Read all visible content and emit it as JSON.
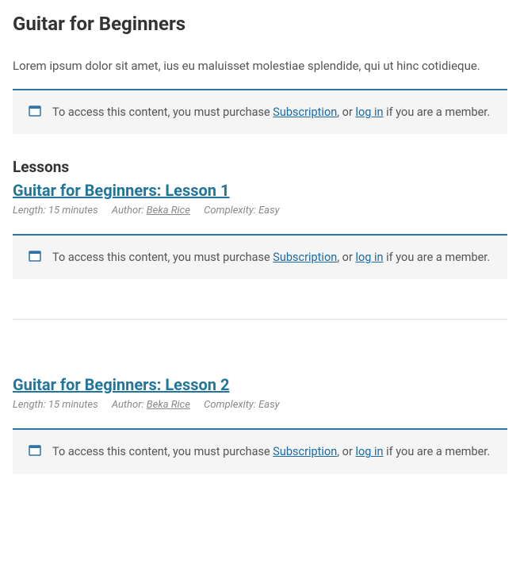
{
  "page": {
    "title": "Guitar for Beginners",
    "intro": "Lorem ipsum dolor sit amet, ius eu maluisset molestiae splendide, qui ut hinc cotidieque."
  },
  "notice": {
    "prefix": "To access this content, you must purchase ",
    "subscription_link": "Subscription",
    "middle": ", or ",
    "login_link": "log in",
    "suffix": " if you are a member."
  },
  "lessons_heading": "Lessons",
  "meta_labels": {
    "length": "Length: ",
    "author": "Author: ",
    "complexity": "Complexity: "
  },
  "lessons": [
    {
      "title": "Guitar for Beginners: Lesson 1",
      "length": "15 minutes",
      "author": "Beka Rice",
      "complexity": "Easy"
    },
    {
      "title": "Guitar for Beginners: Lesson 2",
      "length": "15 minutes",
      "author": "Beka Rice",
      "complexity": "Easy"
    }
  ]
}
